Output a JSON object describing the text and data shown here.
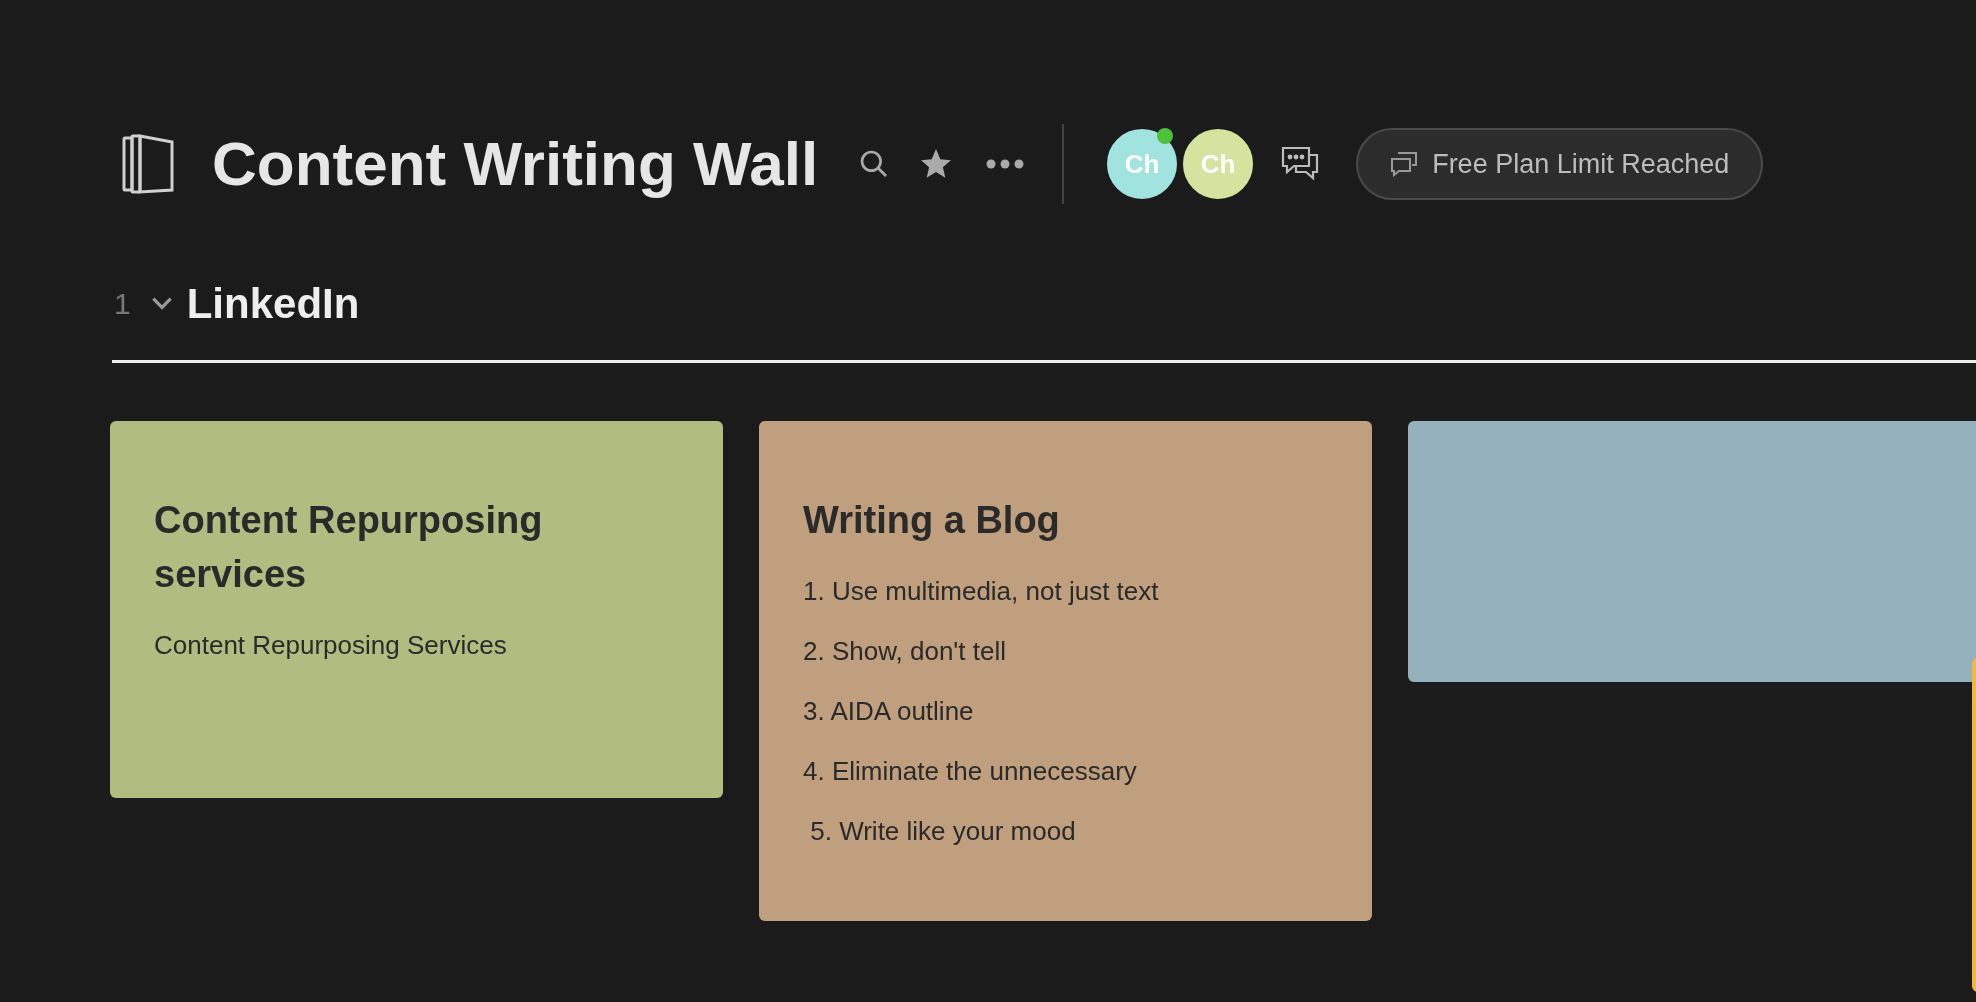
{
  "header": {
    "title": "Content Writing Wall",
    "collaborators": [
      {
        "initials": "Ch",
        "color": "#a0e3df",
        "online": true
      },
      {
        "initials": "Ch",
        "color": "#d4e49f",
        "online": false
      }
    ],
    "plan_button": "Free Plan Limit Reached"
  },
  "section": {
    "number": "1",
    "title": "LinkedIn",
    "expanded": true
  },
  "cards": [
    {
      "color": "#b0bc80",
      "title": "Content Repurposing services",
      "lines": [
        "Content Repurposing Services"
      ]
    },
    {
      "color": "#bf9f7d",
      "title": "Writing a Blog",
      "lines": [
        "1. Use multimedia, not just text",
        "2. Show, don't tell",
        "3. AIDA outline",
        "4. Eliminate the unnecessary",
        " 5. Write like your mood"
      ]
    },
    {
      "color": "#95b1bd"
    }
  ],
  "partial_card": {
    "color": "#f0b93a"
  }
}
